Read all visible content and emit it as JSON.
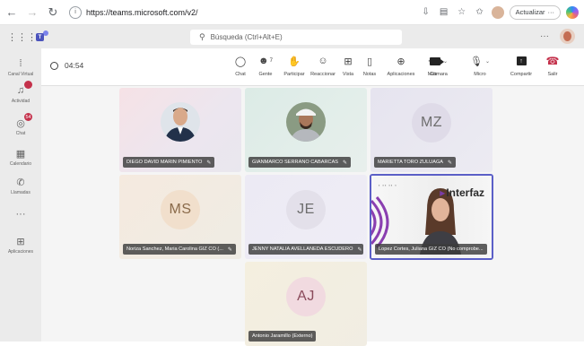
{
  "browser": {
    "url": "https://teams.microsoft.com/v2/",
    "update_label": "Actualizar",
    "update_more": "···"
  },
  "header": {
    "search_placeholder": "Búsqueda (Ctrl+Alt+E)",
    "more": "···"
  },
  "rail": {
    "items": [
      {
        "label": "Canal Virtual",
        "icon": "menu-icon"
      },
      {
        "label": "Actividad",
        "icon": "bell-icon",
        "badge": ""
      },
      {
        "label": "Chat",
        "icon": "chat-icon",
        "badge": "54"
      },
      {
        "label": "Calendario",
        "icon": "calendar-icon"
      },
      {
        "label": "Llamadas",
        "icon": "phone-icon"
      },
      {
        "label": "···",
        "icon": "more-icon"
      },
      {
        "label": "Aplicaciones",
        "icon": "apps-icon"
      }
    ]
  },
  "meeting": {
    "timer": "04:54",
    "tools": [
      {
        "label": "Chat",
        "icon": "chat-icon"
      },
      {
        "label": "Gente",
        "icon": "people-icon",
        "count": "7"
      },
      {
        "label": "Participar",
        "icon": "raise-hand-icon"
      },
      {
        "label": "Reaccionar",
        "icon": "smile-icon"
      },
      {
        "label": "Vista",
        "icon": "grid-view-icon"
      },
      {
        "label": "Notas",
        "icon": "notes-icon"
      },
      {
        "label": "Aplicaciones",
        "icon": "add-app-icon"
      },
      {
        "label": "Más",
        "icon": "more-icon"
      }
    ],
    "av": {
      "camera": "Cámara",
      "mic": "Micro",
      "share": "Compartir",
      "leave": "Salir"
    }
  },
  "participants": [
    {
      "name": "DIEGO DAVID MARIN PIMIENTO",
      "type": "photo",
      "bg": "pink"
    },
    {
      "name": "GIANMARCO SERRANO CABARCAS",
      "type": "photo",
      "bg": "mint"
    },
    {
      "name": "MARIETTA TORO ZULUAGA",
      "initials": "MZ",
      "type": "initials",
      "bg": "lilac"
    },
    {
      "name": "Noriza Sanchez, Maria Carolina GIZ CO (...",
      "initials": "MS",
      "type": "initials",
      "bg": "peach"
    },
    {
      "name": "JENNY NATALIA AVELLANEDA ESCUDERO",
      "initials": "JE",
      "type": "initials",
      "bg": "lavender"
    },
    {
      "name": "Lopez Cortes, Juliana GIZ CO (No comprobe...",
      "type": "video",
      "bg_text": "Interfaz"
    },
    {
      "name": "Antonio Jaramillo (Externo)",
      "initials": "AJ",
      "type": "initials",
      "bg": "cream"
    }
  ],
  "colors": {
    "accent": "#5b5fc7",
    "leave": "#c4314b",
    "badge": "#c4314b"
  }
}
